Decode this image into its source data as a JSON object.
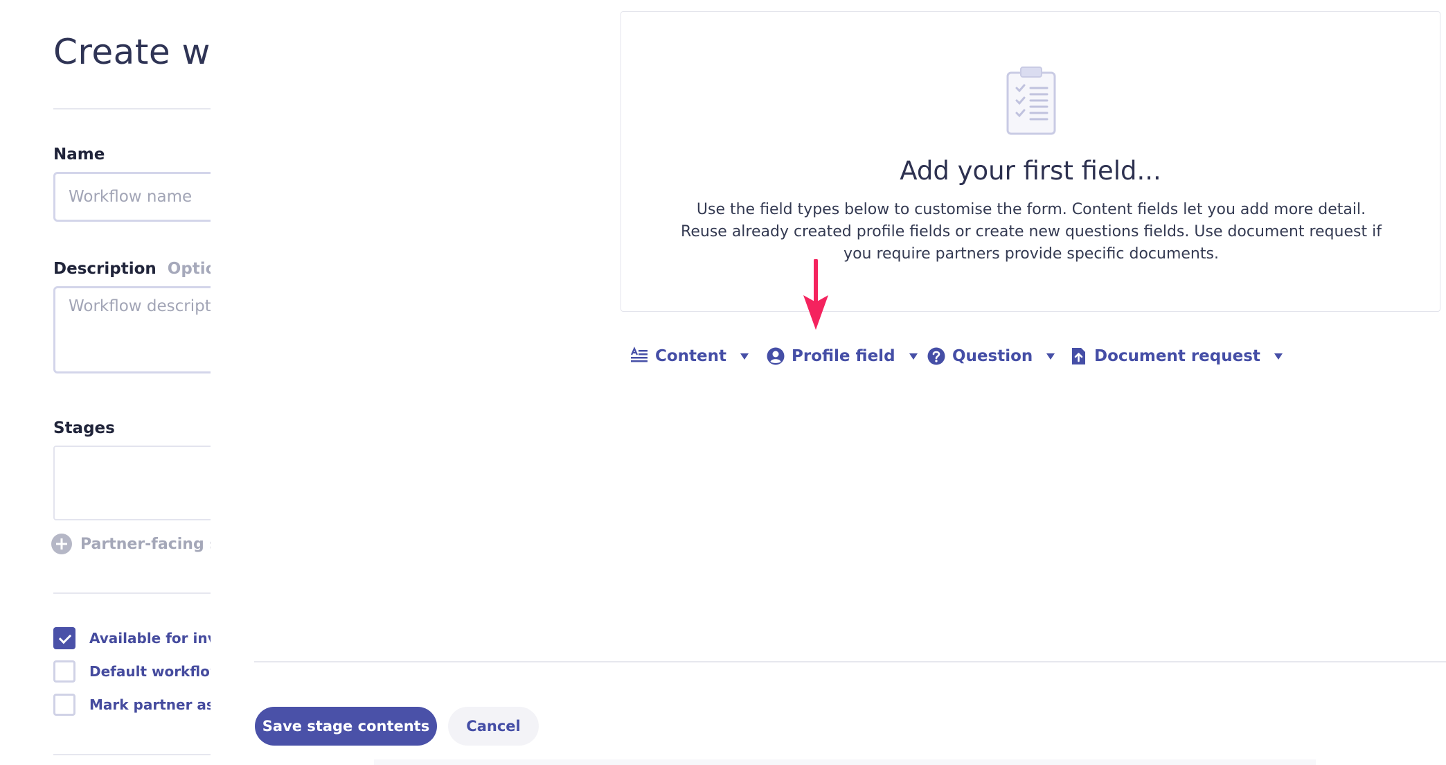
{
  "left_panel": {
    "title": "Create wo",
    "name_field": {
      "label": "Name",
      "placeholder": "Workflow name"
    },
    "description_field": {
      "label": "Description",
      "optional_label": "Optiona",
      "placeholder": "Workflow descriptio"
    },
    "stages": {
      "label": "Stages",
      "add_stage_label": "Partner-facing stag"
    },
    "checkboxes": [
      {
        "label": "Available for invitir",
        "checked": true
      },
      {
        "label": "Default workflow",
        "checked": false
      },
      {
        "label": "Mark partner as ful",
        "checked": false
      }
    ]
  },
  "empty_state": {
    "icon": "clipboard-checklist-icon",
    "title": "Add your first field...",
    "description": "Use the field types below to customise the form. Content fields let you add more detail. Reuse already created profile fields or create new questions fields. Use document request if you require partners provide specific documents."
  },
  "annotation": {
    "icon": "pink-arrow-down-icon",
    "color": "#f4235e"
  },
  "field_types": [
    {
      "label": "Content",
      "icon": "content-text-icon"
    },
    {
      "label": "Profile field",
      "icon": "user-circle-icon"
    },
    {
      "label": "Question",
      "icon": "question-circle-icon"
    },
    {
      "label": "Document request",
      "icon": "document-upload-icon"
    }
  ],
  "footer": {
    "save_label": "Save stage contents",
    "cancel_label": "Cancel"
  },
  "colors": {
    "primary": "#4a51a8",
    "text_dark": "#2d3150",
    "muted": "#a2a5b6",
    "border": "#d3d5ea",
    "arrow": "#f4235e"
  }
}
